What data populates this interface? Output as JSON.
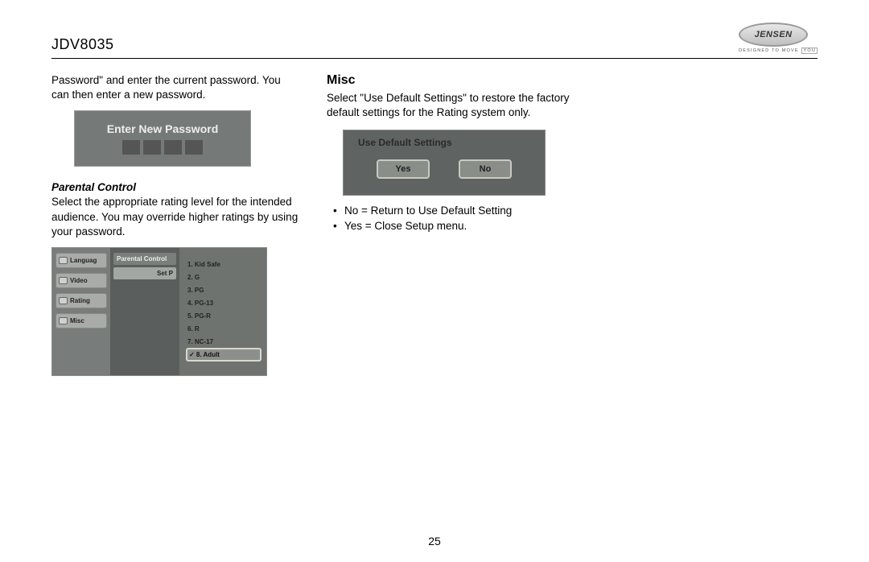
{
  "header": {
    "model": "JDV8035",
    "brand": "JENSEN",
    "tagline": "DESIGNED TO MOVE",
    "tagline_you": "YOU"
  },
  "col1": {
    "intro": "Password\" and enter the current password. You can then enter a new password.",
    "pw_title": "Enter New Password",
    "parental_heading": "Parental Control",
    "parental_text": "Select the appropriate rating level for the intended audience. You may override higher ratings by using your password.",
    "pc_tabs": [
      "Languag",
      "Video",
      "Rating",
      "Misc"
    ],
    "pc_mid_top": "Parental Control",
    "pc_mid_sel": "Set P",
    "pc_ratings": [
      "1. Kid Safe",
      "2. G",
      "3. PG",
      "4. PG-13",
      "5. PG-R",
      "6. R",
      "7. NC-17",
      "✓ 8. Adult"
    ]
  },
  "col2": {
    "heading": "Misc",
    "text": "Select \"Use Default Settings\" to restore the factory default settings for the Rating system only.",
    "uds_title": "Use Default Settings",
    "uds_yes": "Yes",
    "uds_no": "No",
    "bullets": [
      "No = Return to Use Default Setting",
      "Yes = Close Setup menu."
    ]
  },
  "page_number": "25"
}
